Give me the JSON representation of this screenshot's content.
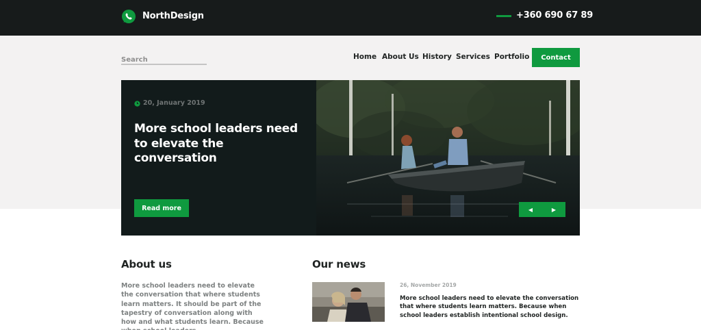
{
  "header": {
    "brand": "NorthDesign",
    "logo_icon": "whatsapp-icon",
    "phone": "+360 690 67 89"
  },
  "search": {
    "placeholder": "Search"
  },
  "nav": {
    "items": [
      {
        "label": "Home"
      },
      {
        "label": "About Us"
      },
      {
        "label": "History"
      },
      {
        "label": "Services"
      },
      {
        "label": "Portfolio"
      }
    ],
    "contact_label": "Contact"
  },
  "hero": {
    "date": "20, January 2019",
    "title": "More school leaders need to elevate the conversation",
    "read_more_label": "Read more",
    "prev_icon": "chevron-left-icon",
    "next_icon": "chevron-right-icon",
    "prev_glyph": "◀",
    "next_glyph": "▶"
  },
  "about": {
    "title": "About us",
    "text": "More school leaders need to elevate the conversation that where students learn matters. It should be part of the tapestry of conversation along with how and what students learn. Because when school leaders"
  },
  "news": {
    "title": "Our news",
    "items": [
      {
        "date": "26, November 2019",
        "text": "More school leaders need to elevate the conversation that where students learn matters. Because when school leaders establish intentional school design."
      }
    ]
  },
  "colors": {
    "accent": "#0f9a3f",
    "dark": "#171b1b",
    "hero_bg": "#f3f2f2"
  }
}
